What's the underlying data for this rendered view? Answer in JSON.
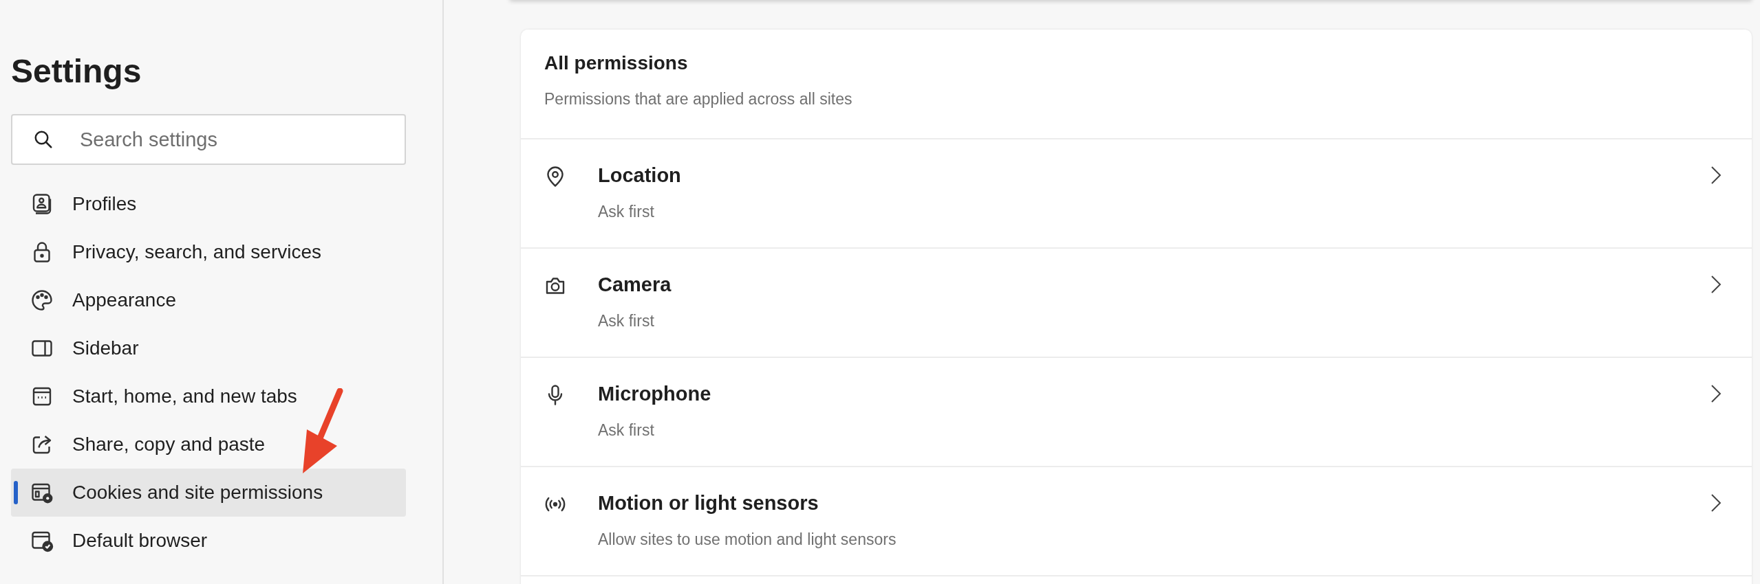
{
  "sidebar": {
    "title": "Settings",
    "search": {
      "placeholder": "Search settings"
    },
    "items": [
      {
        "label": "Profiles",
        "kind": "profile",
        "selected": false
      },
      {
        "label": "Privacy, search, and services",
        "kind": "lock",
        "selected": false
      },
      {
        "label": "Appearance",
        "kind": "palette",
        "selected": false
      },
      {
        "label": "Sidebar",
        "kind": "sidebar",
        "selected": false
      },
      {
        "label": "Start, home, and new tabs",
        "kind": "home",
        "selected": false
      },
      {
        "label": "Share, copy and paste",
        "kind": "share",
        "selected": false
      },
      {
        "label": "Cookies and site permissions",
        "kind": "cookies",
        "selected": true
      },
      {
        "label": "Default browser",
        "kind": "browser",
        "selected": false
      }
    ]
  },
  "main": {
    "section": {
      "title": "All permissions",
      "subtitle": "Permissions that are applied across all sites"
    },
    "permissions": [
      {
        "kind": "location",
        "title": "Location",
        "status": "Ask first"
      },
      {
        "kind": "camera",
        "title": "Camera",
        "status": "Ask first"
      },
      {
        "kind": "microphone",
        "title": "Microphone",
        "status": "Ask first"
      },
      {
        "kind": "sensors",
        "title": "Motion or light sensors",
        "status": "Allow sites to use motion and light sensors"
      }
    ]
  }
}
